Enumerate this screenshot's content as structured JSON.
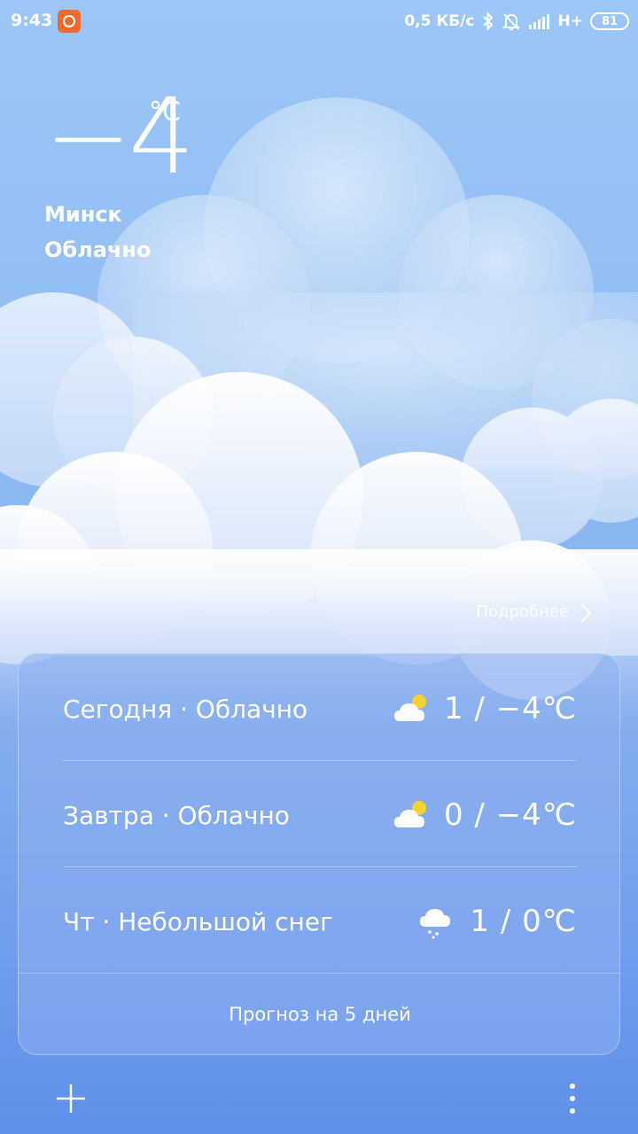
{
  "status_bar": {
    "time": "9:43",
    "network_speed": "0,5 КБ/с",
    "network_type": "H+",
    "battery": "81",
    "icons": [
      "mi-app-icon",
      "bluetooth-icon",
      "bell-off-icon",
      "signal-icon",
      "battery-icon"
    ]
  },
  "current": {
    "temperature": "−4",
    "unit": "°C",
    "city": "Минск",
    "condition": "Облачно"
  },
  "details_link": "Подробнее",
  "forecast": [
    {
      "label": "Сегодня · Облачно",
      "icon": "partly-cloudy-icon",
      "temps": "1 / −4℃"
    },
    {
      "label": "Завтра · Облачно",
      "icon": "partly-cloudy-icon",
      "temps": "0 / −4℃"
    },
    {
      "label": "Чт · Небольшой снег",
      "icon": "light-snow-icon",
      "temps": "1 / 0℃"
    }
  ],
  "five_day_link": "Прогноз на 5 дней",
  "bottom_bar": {
    "add_icon": "plus-icon",
    "menu_icon": "more-vertical-icon"
  },
  "colors": {
    "sky_top": "#9cc6f6",
    "sky_bottom": "#5f8fe9",
    "sun": "#f5d230"
  }
}
